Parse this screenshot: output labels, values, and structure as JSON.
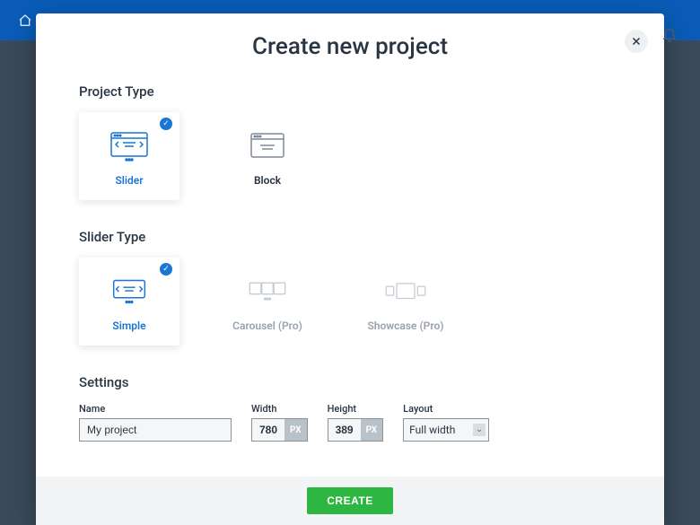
{
  "modal": {
    "title": "Create new project",
    "sections": {
      "project_type": {
        "label": "Project Type",
        "options": [
          {
            "label": "Slider",
            "selected": true
          },
          {
            "label": "Block",
            "selected": false
          }
        ]
      },
      "slider_type": {
        "label": "Slider Type",
        "options": [
          {
            "label": "Simple",
            "selected": true,
            "disabled": false
          },
          {
            "label": "Carousel (Pro)",
            "selected": false,
            "disabled": true
          },
          {
            "label": "Showcase (Pro)",
            "selected": false,
            "disabled": true
          }
        ]
      },
      "settings": {
        "label": "Settings",
        "name": {
          "label": "Name",
          "value": "My project"
        },
        "width": {
          "label": "Width",
          "value": "780",
          "unit": "PX"
        },
        "height": {
          "label": "Height",
          "value": "389",
          "unit": "PX"
        },
        "layout": {
          "label": "Layout",
          "value": "Full width"
        }
      }
    },
    "create_button": "CREATE"
  }
}
